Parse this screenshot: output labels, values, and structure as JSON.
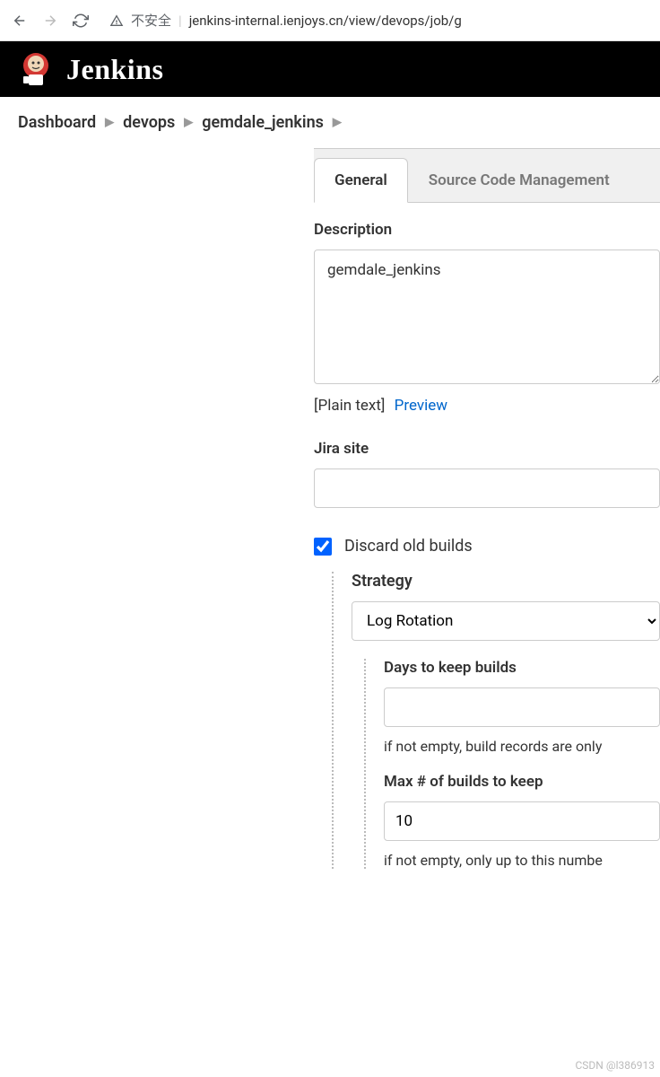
{
  "browser": {
    "not_secure_label": "不安全",
    "url": "jenkins-internal.ienjoys.cn/view/devops/job/g"
  },
  "header": {
    "title": "Jenkins"
  },
  "breadcrumbs": {
    "items": [
      "Dashboard",
      "devops",
      "gemdale_jenkins"
    ]
  },
  "tabs": {
    "general": "General",
    "source_code": "Source Code Management"
  },
  "form": {
    "description_label": "Description",
    "description_value": "gemdale_jenkins",
    "plain_text_label": "[Plain text]",
    "preview_label": "Preview",
    "jira_label": "Jira site",
    "jira_value": "",
    "discard_label": "Discard old builds",
    "discard_checked": true,
    "strategy_label": "Strategy",
    "strategy_value": "Log Rotation",
    "days_label": "Days to keep builds",
    "days_value": "",
    "days_help": "if not empty, build records are only",
    "max_label": "Max # of builds to keep",
    "max_value": "10",
    "max_help": "if not empty, only up to this numbe"
  },
  "watermark": "CSDN @l386913"
}
